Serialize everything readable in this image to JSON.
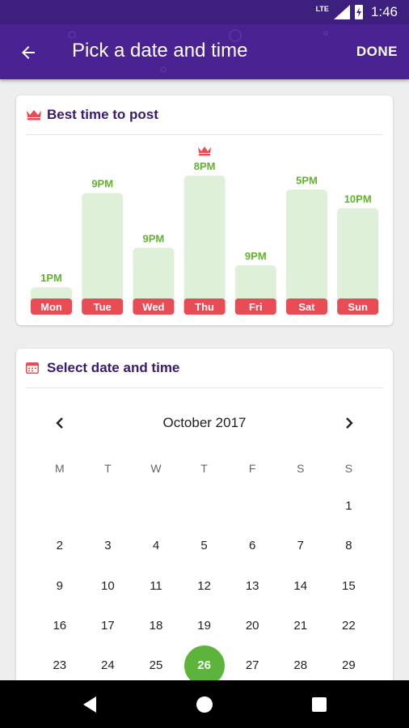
{
  "status_bar": {
    "network": "LTE",
    "time": "1:46"
  },
  "app_bar": {
    "title": "Pick a date and time",
    "done_label": "DONE"
  },
  "best_time": {
    "title": "Best time to post",
    "accent_red": "#e84c55",
    "bar_green": "#dff0d8",
    "label_green": "#62b22e",
    "best_day": "Thu",
    "days": [
      {
        "day": "Mon",
        "time": "1PM",
        "score": 0.04
      },
      {
        "day": "Tue",
        "time": "9PM",
        "score": 0.85
      },
      {
        "day": "Wed",
        "time": "9PM",
        "score": 0.38
      },
      {
        "day": "Thu",
        "time": "8PM",
        "score": 1.0
      },
      {
        "day": "Fri",
        "time": "9PM",
        "score": 0.23
      },
      {
        "day": "Sat",
        "time": "5PM",
        "score": 0.88
      },
      {
        "day": "Sun",
        "time": "10PM",
        "score": 0.72
      }
    ]
  },
  "calendar": {
    "title": "Select date and time",
    "month": "October 2017",
    "weekdays": [
      "M",
      "T",
      "W",
      "T",
      "F",
      "S",
      "S"
    ],
    "leading_blanks": 6,
    "days": [
      "1",
      "2",
      "3",
      "4",
      "5",
      "6",
      "7",
      "8",
      "9",
      "10",
      "11",
      "12",
      "13",
      "14",
      "15",
      "16",
      "17",
      "18",
      "19",
      "20",
      "21",
      "22",
      "23",
      "24",
      "25",
      "26",
      "27",
      "28",
      "29"
    ],
    "selected": "26",
    "selected_color": "#5cb53a"
  }
}
